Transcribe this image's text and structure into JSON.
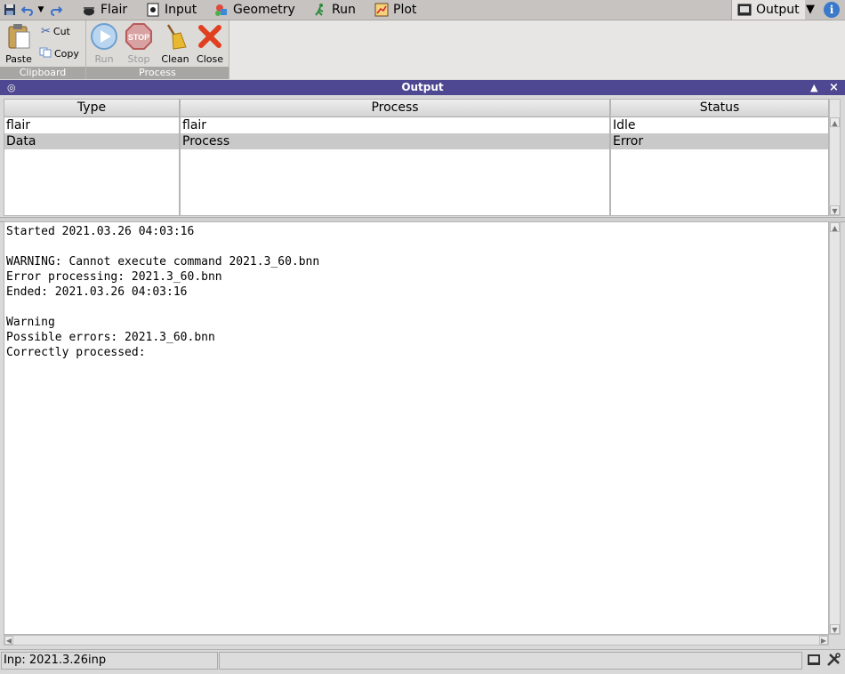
{
  "tabs": {
    "flair": "Flair",
    "input": "Input",
    "geometry": "Geometry",
    "run": "Run",
    "plot": "Plot",
    "output": "Output"
  },
  "ribbon": {
    "clipboard": {
      "label": "Clipboard",
      "paste": "Paste",
      "cut": "Cut",
      "copy": "Copy"
    },
    "process": {
      "label": "Process",
      "run": "Run",
      "stop": "Stop",
      "clean": "Clean",
      "close": "Close"
    }
  },
  "panel": {
    "title": "Output"
  },
  "table": {
    "headers": {
      "type": "Type",
      "process": "Process",
      "status": "Status"
    },
    "rows": [
      {
        "type": "flair",
        "process": "flair",
        "status": "Idle"
      },
      {
        "type": "Data",
        "process": "Process",
        "status": "Error"
      }
    ]
  },
  "console": {
    "text": "Started 2021.03.26 04:03:16\n\nWARNING: Cannot execute command 2021.3_60.bnn\nError processing: 2021.3_60.bnn\nEnded: 2021.03.26 04:03:16\n\nWarning\nPossible errors: 2021.3_60.bnn\nCorrectly processed:"
  },
  "status": {
    "input": "Inp: 2021.3.26inp"
  },
  "colors": {
    "panel_bar": "#4e4791",
    "selected_row": "#c9c9c9"
  }
}
